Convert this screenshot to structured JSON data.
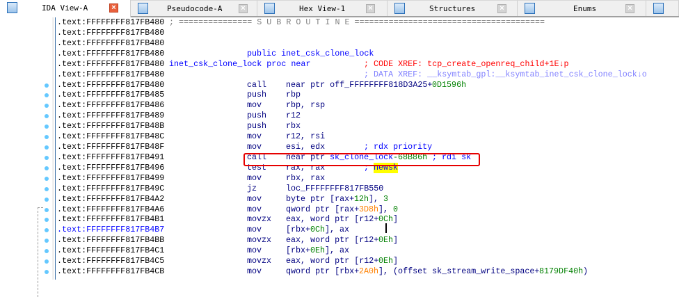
{
  "tabs": [
    {
      "label": "IDA View-A",
      "icon": "disassembly-view-icon",
      "active": true
    },
    {
      "label": "Pseudocode-A",
      "icon": "pseudocode-icon",
      "active": false
    },
    {
      "label": "Hex View-1",
      "icon": "hex-view-icon",
      "active": false
    },
    {
      "label": "Structures",
      "icon": "structures-icon",
      "active": false
    },
    {
      "label": "Enums",
      "icon": "enums-icon",
      "active": false
    },
    {
      "label": "",
      "icon": "imports-icon",
      "active": false
    }
  ],
  "colors": {
    "accent": "#3a6ea5",
    "highlight_box": "#e60000",
    "breakpoint_dot": "#64c8ff"
  },
  "lines": [
    {
      "addr": ".text:FFFFFFFF817FB480",
      "segs": [
        {
          "col": 23,
          "t": "; =============== S U B R O U T I N E =======================================",
          "c": "gray"
        }
      ]
    },
    {
      "addr": ".text:FFFFFFFF817FB480",
      "segs": []
    },
    {
      "addr": ".text:FFFFFFFF817FB480",
      "segs": []
    },
    {
      "addr": ".text:FFFFFFFF817FB480",
      "segs": [
        {
          "col": 39,
          "t": "public inet_csk_clone_lock",
          "c": "blue"
        }
      ]
    },
    {
      "addr": ".text:FFFFFFFF817FB480",
      "segs": [
        {
          "col": 23,
          "t": "inet_csk_clone_lock proc near",
          "c": "blue"
        },
        {
          "col": 63,
          "t": "; CODE XREF: tcp_create_openreq_child+1E↓p",
          "c": "red"
        }
      ]
    },
    {
      "addr": ".text:FFFFFFFF817FB480",
      "segs": [
        {
          "col": 63,
          "t": "; DATA XREF: __ksymtab_gpl:__ksymtab_inet_csk_clone_lock↓o",
          "c": "lblue"
        }
      ]
    },
    {
      "addr": ".text:FFFFFFFF817FB480",
      "dot": true,
      "segs": [
        {
          "col": 39,
          "t": "call",
          "c": "navy"
        },
        {
          "col": 47,
          "t": "near ptr off_FFFFFFFF818D3A25+",
          "c": "navy"
        },
        {
          "col": 77,
          "t": "0D1596h",
          "c": "green"
        }
      ]
    },
    {
      "addr": ".text:FFFFFFFF817FB485",
      "dot": true,
      "segs": [
        {
          "col": 39,
          "t": "push",
          "c": "navy"
        },
        {
          "col": 47,
          "t": "rbp",
          "c": "navy"
        }
      ]
    },
    {
      "addr": ".text:FFFFFFFF817FB486",
      "dot": true,
      "segs": [
        {
          "col": 39,
          "t": "mov",
          "c": "navy"
        },
        {
          "col": 47,
          "t": "rbp, rsp",
          "c": "navy"
        }
      ]
    },
    {
      "addr": ".text:FFFFFFFF817FB489",
      "dot": true,
      "segs": [
        {
          "col": 39,
          "t": "push",
          "c": "navy"
        },
        {
          "col": 47,
          "t": "r12",
          "c": "navy"
        }
      ]
    },
    {
      "addr": ".text:FFFFFFFF817FB48B",
      "dot": true,
      "segs": [
        {
          "col": 39,
          "t": "push",
          "c": "navy"
        },
        {
          "col": 47,
          "t": "rbx",
          "c": "navy"
        }
      ]
    },
    {
      "addr": ".text:FFFFFFFF817FB48C",
      "dot": true,
      "segs": [
        {
          "col": 39,
          "t": "mov",
          "c": "navy"
        },
        {
          "col": 47,
          "t": "r12, rsi",
          "c": "navy"
        }
      ]
    },
    {
      "addr": ".text:FFFFFFFF817FB48F",
      "dot": true,
      "segs": [
        {
          "col": 39,
          "t": "mov",
          "c": "navy"
        },
        {
          "col": 47,
          "t": "esi, edx",
          "c": "navy"
        },
        {
          "col": 63,
          "t": "; rdx priority",
          "c": "blue"
        }
      ]
    },
    {
      "addr": ".text:FFFFFFFF817FB491",
      "dot": true,
      "segs": [
        {
          "col": 39,
          "t": "call",
          "c": "navy"
        },
        {
          "col": 47,
          "t": "near ptr ",
          "c": "navy"
        },
        {
          "col": 56,
          "t": "sk_clone_lock",
          "c": "blue"
        },
        {
          "col": 69,
          "t": "-68B86h",
          "c": "green"
        },
        {
          "col": 77,
          "t": "; rdi sk",
          "c": "blue"
        }
      ]
    },
    {
      "addr": ".text:FFFFFFFF817FB496",
      "dot": true,
      "segs": [
        {
          "col": 39,
          "t": "test",
          "c": "navy"
        },
        {
          "col": 47,
          "t": "rax, rax",
          "c": "navy"
        },
        {
          "col": 63,
          "t": "; ",
          "c": "blue"
        },
        {
          "col": 65,
          "t": "newsk",
          "c": "hl"
        }
      ]
    },
    {
      "addr": ".text:FFFFFFFF817FB499",
      "dot": true,
      "segs": [
        {
          "col": 39,
          "t": "mov",
          "c": "navy"
        },
        {
          "col": 47,
          "t": "rbx, rax",
          "c": "navy"
        }
      ]
    },
    {
      "addr": ".text:FFFFFFFF817FB49C",
      "dot": true,
      "segs": [
        {
          "col": 39,
          "t": "jz",
          "c": "navy"
        },
        {
          "col": 47,
          "t": "loc_FFFFFFFF817FB550",
          "c": "navy"
        }
      ]
    },
    {
      "addr": ".text:FFFFFFFF817FB4A2",
      "dot": true,
      "segs": [
        {
          "col": 39,
          "t": "mov",
          "c": "navy"
        },
        {
          "col": 47,
          "t": "byte ptr [rax+",
          "c": "navy"
        },
        {
          "col": 61,
          "t": "12h",
          "c": "green"
        },
        {
          "col": 64,
          "t": "], ",
          "c": "navy"
        },
        {
          "col": 67,
          "t": "3",
          "c": "green"
        }
      ]
    },
    {
      "addr": ".text:FFFFFFFF817FB4A6",
      "dot": true,
      "segs": [
        {
          "col": 39,
          "t": "mov",
          "c": "navy"
        },
        {
          "col": 47,
          "t": "qword ptr [rax+",
          "c": "navy"
        },
        {
          "col": 62,
          "t": "3D8h",
          "c": "orange"
        },
        {
          "col": 66,
          "t": "], ",
          "c": "navy"
        },
        {
          "col": 69,
          "t": "0",
          "c": "green"
        }
      ]
    },
    {
      "addr": ".text:FFFFFFFF817FB4B1",
      "dot": true,
      "segs": [
        {
          "col": 39,
          "t": "movzx",
          "c": "navy"
        },
        {
          "col": 47,
          "t": "eax, word ptr [r12+",
          "c": "navy"
        },
        {
          "col": 66,
          "t": "0Ch",
          "c": "green"
        },
        {
          "col": 69,
          "t": "]",
          "c": "navy"
        }
      ]
    },
    {
      "addr": ".text:FFFFFFFF817FB4B7",
      "sel": true,
      "dot": true,
      "segs": [
        {
          "col": 39,
          "t": "mov",
          "c": "navy"
        },
        {
          "col": 47,
          "t": "[rbx+",
          "c": "navy"
        },
        {
          "col": 52,
          "t": "0Ch",
          "c": "green"
        },
        {
          "col": 55,
          "t": "], ax",
          "c": "navy"
        }
      ]
    },
    {
      "addr": ".text:FFFFFFFF817FB4BB",
      "dot": true,
      "segs": [
        {
          "col": 39,
          "t": "movzx",
          "c": "navy"
        },
        {
          "col": 47,
          "t": "eax, word ptr [r12+",
          "c": "navy"
        },
        {
          "col": 66,
          "t": "0Eh",
          "c": "green"
        },
        {
          "col": 69,
          "t": "]",
          "c": "navy"
        }
      ]
    },
    {
      "addr": ".text:FFFFFFFF817FB4C1",
      "dot": true,
      "segs": [
        {
          "col": 39,
          "t": "mov",
          "c": "navy"
        },
        {
          "col": 47,
          "t": "[rbx+",
          "c": "navy"
        },
        {
          "col": 52,
          "t": "0Eh",
          "c": "green"
        },
        {
          "col": 55,
          "t": "], ax",
          "c": "navy"
        }
      ]
    },
    {
      "addr": ".text:FFFFFFFF817FB4C5",
      "dot": true,
      "segs": [
        {
          "col": 39,
          "t": "movzx",
          "c": "navy"
        },
        {
          "col": 47,
          "t": "eax, word ptr [r12+",
          "c": "navy"
        },
        {
          "col": 66,
          "t": "0Eh",
          "c": "green"
        },
        {
          "col": 69,
          "t": "]",
          "c": "navy"
        }
      ]
    },
    {
      "addr": ".text:FFFFFFFF817FB4CB",
      "dot": true,
      "segs": [
        {
          "col": 39,
          "t": "mov",
          "c": "navy"
        },
        {
          "col": 47,
          "t": "qword ptr [rbx+",
          "c": "navy"
        },
        {
          "col": 62,
          "t": "2A0h",
          "c": "orange"
        },
        {
          "col": 66,
          "t": "], (offset sk_stream_write_space+",
          "c": "navy"
        },
        {
          "col": 99,
          "t": "8179DF40h",
          "c": "green"
        },
        {
          "col": 108,
          "t": ")",
          "c": "navy"
        }
      ]
    }
  ]
}
